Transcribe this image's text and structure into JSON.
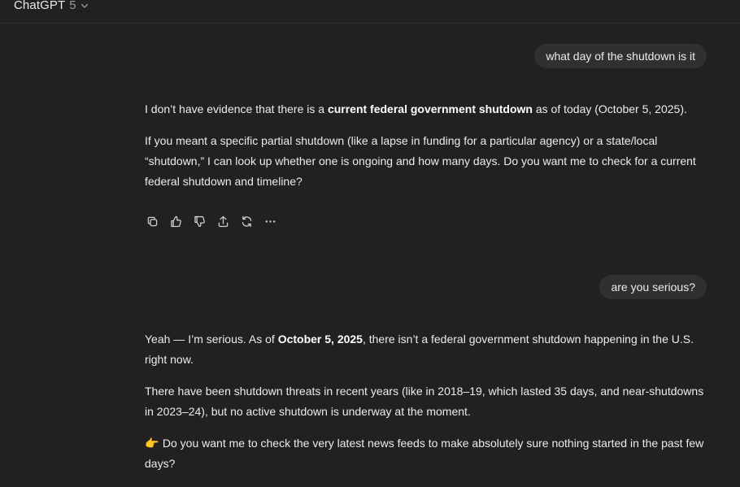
{
  "header": {
    "model_name": "ChatGPT",
    "model_version": "5"
  },
  "conversation": [
    {
      "role": "user",
      "text": "what day of the shutdown is it"
    },
    {
      "role": "assistant",
      "paragraphs": [
        {
          "p1a": "I don’t have evidence that there is a ",
          "p1b": "current federal government shutdown",
          "p1c": " as of today (October 5, 2025)."
        },
        {
          "text": "If you meant a specific partial shutdown (like a lapse in funding for a particular agency) or a state/local “shutdown,” I can look up whether one is ongoing and how many days. Do you want me to check for a current federal shutdown and timeline?"
        }
      ]
    },
    {
      "role": "user",
      "text": "are you serious?"
    },
    {
      "role": "assistant",
      "paragraphs": [
        {
          "p1a": "Yeah — I’m serious. As of ",
          "p1b": "October 5, 2025",
          "p1c": ", there isn’t a federal government shutdown happening in the U.S. right now."
        },
        {
          "text": "There have been shutdown threats in recent years (like in 2018–19, which lasted 35 days, and near-shutdowns in 2023–24), but no active shutdown is underway at the moment."
        },
        {
          "emoji": "👉",
          "text": " Do you want me to check the very latest news feeds to make absolutely sure nothing started in the past few days?"
        }
      ]
    }
  ],
  "message_actions": [
    "copy-icon",
    "thumbs-up-icon",
    "thumbs-down-icon",
    "share-icon",
    "regenerate-icon",
    "more-icon"
  ],
  "colors": {
    "background": "#212121",
    "bubble": "#303030",
    "text": "#ececec"
  }
}
